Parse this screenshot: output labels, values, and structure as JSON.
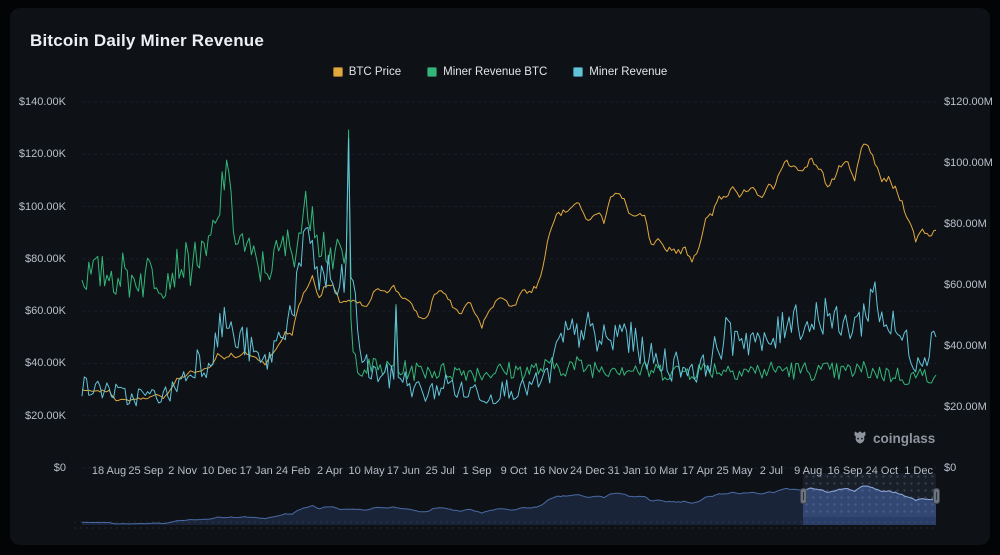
{
  "app": {
    "title": "Bitcoin Daily Miner Revenue",
    "watermark_text": "coinglass"
  },
  "colors": {
    "page_bg": "#030405",
    "panel_bg": "#0E1116",
    "grid": "#262B33",
    "axis_text": "#B9C0CA",
    "title_text": "#EDEFF2",
    "btc_price": "#E2A93F",
    "miner_revenue_btc": "#33B679",
    "miner_revenue": "#62C4D9",
    "nav_line": "#4A6AA5",
    "nav_fill": "#1A2439",
    "nav_line_sel": "#8FA9D9",
    "nav_fill_sel": "#2E4370"
  },
  "legend": {
    "items": [
      {
        "label": "BTC Price",
        "color": "#E2A93F"
      },
      {
        "label": "Miner Revenue BTC",
        "color": "#33B679"
      },
      {
        "label": "Miner Revenue",
        "color": "#62C4D9"
      }
    ]
  },
  "chart_data": {
    "type": "line",
    "title": "Bitcoin Daily Miner Revenue",
    "grid": true,
    "legend_position": "top-center",
    "x_start": "21 Jul 2023",
    "x_end": "19 Dec 2025",
    "sample_interval": "weekly (approx, noisy daily rendering)",
    "x_tick_labels": [
      "18 Aug",
      "25 Sep",
      "2 Nov",
      "10 Dec",
      "17 Jan",
      "24 Feb",
      "2 Apr",
      "10 May",
      "17 Jun",
      "25 Jul",
      "1 Sep",
      "9 Oct",
      "16 Nov",
      "24 Dec",
      "31 Jan",
      "10 Mar",
      "17 Apr",
      "25 May",
      "2 Jul",
      "9 Aug",
      "16 Sep",
      "24 Oct",
      "1 Dec"
    ],
    "left_axis": {
      "title": "BTC Price (USD)",
      "ylim": [
        0,
        140000
      ],
      "ticks": [
        {
          "label": "$140.00K",
          "v": 140
        },
        {
          "label": "$120.00K",
          "v": 120
        },
        {
          "label": "$100.00K",
          "v": 100
        },
        {
          "label": "$80.00K",
          "v": 80
        },
        {
          "label": "$60.00K",
          "v": 60
        },
        {
          "label": "$40.00K",
          "v": 40
        },
        {
          "label": "$20.00K",
          "v": 20
        },
        {
          "label": "$0",
          "v": 0
        }
      ]
    },
    "right_axis": {
      "title": "Miner Revenue (USD)",
      "ylim": [
        0,
        120000000
      ],
      "ticks": [
        {
          "label": "$120.00M",
          "v": 120
        },
        {
          "label": "$100.00M",
          "v": 100
        },
        {
          "label": "$80.00M",
          "v": 80
        },
        {
          "label": "$60.00M",
          "v": 60
        },
        {
          "label": "$40.00M",
          "v": 40
        },
        {
          "label": "$20.00M",
          "v": 20
        },
        {
          "label": "$0",
          "v": 0
        }
      ]
    },
    "hidden_btc_axis_ylim": [
      0,
      1700
    ],
    "series": [
      {
        "name": "BTC Price",
        "axis": "left",
        "unit": "K USD",
        "max": 140,
        "noise": 0.013,
        "spikes": [],
        "values": [
          30.0,
          29.4,
          29.2,
          29.5,
          29.4,
          26.1,
          26.0,
          25.9,
          26.5,
          26.6,
          27.0,
          27.9,
          26.9,
          29.7,
          34.1,
          34.7,
          37.1,
          36.5,
          37.7,
          38.7,
          43.7,
          41.9,
          43.6,
          42.1,
          44.2,
          42.9,
          41.6,
          40.0,
          43.1,
          47.1,
          51.7,
          51.3,
          62.4,
          68.3,
          73.1,
          65.3,
          69.9,
          69.4,
          63.8,
          63.8,
          63.5,
          62.9,
          61.2,
          66.9,
          68.5,
          67.8,
          69.3,
          66.0,
          64.1,
          61.0,
          57.0,
          57.9,
          66.7,
          67.9,
          64.6,
          60.9,
          58.9,
          64.1,
          59.1,
          53.9,
          60.5,
          63.3,
          65.8,
          62.1,
          62.9,
          68.4,
          67.0,
          69.4,
          76.5,
          91.0,
          98.0,
          97.5,
          99.9,
          101.4,
          97.2,
          94.3,
          98.2,
          94.6,
          104.5,
          104.8,
          102.1,
          96.6,
          96.1,
          96.2,
          84.7,
          86.7,
          83.7,
          84.1,
          82.6,
          83.8,
          79.6,
          84.5,
          94.7,
          96.9,
          104.0,
          103.5,
          109.0,
          104.1,
          105.6,
          106.1,
          103.3,
          107.1,
          108.0,
          112.5,
          118.0,
          115.1,
          113.4,
          116.7,
          117.4,
          113.5,
          108.4,
          110.9,
          115.9,
          115.7,
          109.6,
          122.2,
          124.5,
          115.0,
          110.5,
          110.1,
          106.6,
          101.5,
          94.9,
          87.3,
          91.3,
          89.0,
          91.0
        ]
      },
      {
        "name": "Miner Revenue BTC",
        "axis": "hidden-btc",
        "unit": "BTC/day",
        "max": 1700,
        "noise": 0.1,
        "spikes": [
          {
            "t": 0.169,
            "v": 1430
          },
          {
            "t": 0.3123,
            "v": 1570
          },
          {
            "t": 0.3675,
            "v": 760
          }
        ],
        "values": [
          910,
          895,
          905,
          900,
          905,
          880,
          915,
          870,
          895,
          870,
          930,
          885,
          875,
          900,
          940,
          960,
          940,
          1005,
          955,
          1060,
          1120,
          1390,
          1180,
          1080,
          1030,
          970,
          940,
          925,
          955,
          990,
          1035,
          1010,
          1090,
          1180,
          1240,
          1075,
          1030,
          990,
          960,
          985,
          520,
          475,
          462,
          470,
          465,
          458,
          468,
          452,
          455,
          448,
          452,
          458,
          450,
          446,
          452,
          448,
          446,
          450,
          444,
          440,
          446,
          452,
          448,
          452,
          450,
          455,
          452,
          458,
          462,
          470,
          474,
          470,
          472,
          476,
          470,
          466,
          468,
          464,
          470,
          472,
          466,
          460,
          456,
          452,
          450,
          452,
          448,
          450,
          446,
          450,
          452,
          456,
          458,
          462,
          456,
          458,
          460,
          454,
          456,
          450,
          448,
          452,
          456,
          460,
          458,
          454,
          450,
          452,
          450,
          446,
          450,
          446,
          444,
          448,
          452,
          456,
          452,
          446,
          440,
          436,
          432,
          426,
          420,
          428,
          430,
          434,
          432
        ]
      },
      {
        "name": "Miner Revenue",
        "axis": "right",
        "unit": "M USD",
        "max": 120,
        "noise": 0.14,
        "spikes": [
          {
            "t": 0.3123,
            "v": 108
          },
          {
            "t": 0.3675,
            "v": 53
          }
        ],
        "values": [
          27,
          26,
          25.5,
          26,
          26,
          24.5,
          23.8,
          22.5,
          23.5,
          24,
          23,
          24.5,
          23.5,
          24.5,
          27.5,
          30,
          31,
          36,
          33,
          37,
          43,
          49.5,
          44,
          41,
          42,
          38,
          35.5,
          34,
          38,
          42,
          48,
          52,
          63,
          70.5,
          75.5,
          61,
          64,
          60,
          56,
          64,
          58,
          40,
          33,
          30.5,
          31.5,
          30,
          29.5,
          31,
          27.5,
          26.5,
          25,
          24,
          25.5,
          27,
          28,
          26.5,
          25,
          24.5,
          26,
          24.5,
          23,
          24.5,
          25.5,
          26.5,
          25.5,
          25.5,
          27,
          27.5,
          28.5,
          31,
          38,
          42.5,
          44,
          43,
          47.5,
          44,
          40.5,
          43.5,
          40,
          44.5,
          45.5,
          42,
          39.5,
          38,
          36,
          34,
          35.5,
          33,
          34.5,
          32.5,
          33.5,
          31,
          34,
          37.5,
          39.5,
          43.5,
          42.5,
          45.5,
          42,
          43.5,
          40,
          39.5,
          42.5,
          44,
          50,
          51,
          48,
          46.5,
          49,
          50,
          52.5,
          47,
          45.5,
          46.5,
          49,
          47,
          55,
          57.5,
          50,
          47,
          45,
          42.5,
          40,
          35.5,
          37,
          40,
          43
        ]
      }
    ],
    "navigator": {
      "source_series": "BTC Price",
      "selection_start_frac": 0.8443,
      "selection_end_frac": 1.0
    }
  }
}
